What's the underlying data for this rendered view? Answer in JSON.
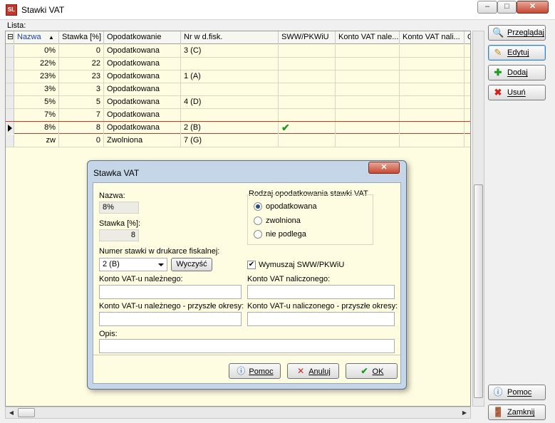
{
  "window": {
    "title": "Stawki VAT",
    "icon_label": "SL",
    "controls": {
      "minimize": "–",
      "maximize": "□",
      "close": "✕"
    }
  },
  "lista_label": "Lista:",
  "grid": {
    "columns": [
      "Nazwa",
      "Stawka [%]",
      "Opodatkowanie",
      "Nr w d.fisk.",
      "SWW/PKWiU",
      "Konto VAT nale...",
      "Konto VAT nali...",
      "O"
    ],
    "sort_indicator": "▲",
    "rows": [
      {
        "nazwa": "0%",
        "stawka": "0",
        "opodatkowanie": "Opodatkowana",
        "nr": "3 (C)",
        "sww": ""
      },
      {
        "nazwa": "22%",
        "stawka": "22",
        "opodatkowanie": "Opodatkowana",
        "nr": "",
        "sww": ""
      },
      {
        "nazwa": "23%",
        "stawka": "23",
        "opodatkowanie": "Opodatkowana",
        "nr": "1 (A)",
        "sww": ""
      },
      {
        "nazwa": "3%",
        "stawka": "3",
        "opodatkowanie": "Opodatkowana",
        "nr": "",
        "sww": ""
      },
      {
        "nazwa": "5%",
        "stawka": "5",
        "opodatkowanie": "Opodatkowana",
        "nr": "4 (D)",
        "sww": ""
      },
      {
        "nazwa": "7%",
        "stawka": "7",
        "opodatkowanie": "Opodatkowana",
        "nr": "",
        "sww": ""
      },
      {
        "nazwa": "8%",
        "stawka": "8",
        "opodatkowanie": "Opodatkowana",
        "nr": "2 (B)",
        "sww": "✔"
      },
      {
        "nazwa": "zw",
        "stawka": "0",
        "opodatkowanie": "Zwolniona",
        "nr": "7 (G)",
        "sww": ""
      }
    ],
    "selected_row_index": 6
  },
  "side_buttons": {
    "przegladaj": "Przeglądaj",
    "edytuj": "Edytuj",
    "dodaj": "Dodaj",
    "usun": "Usuń",
    "pomoc": "Pomoc",
    "zamknij": "Zamknij"
  },
  "dialog": {
    "title": "Stawka VAT",
    "close": "✕",
    "nazwa_label": "Nazwa:",
    "nazwa_value": "8%",
    "stawka_label": "Stawka [%]:",
    "stawka_value": "8",
    "rodzaj_label": "Rodzaj opodatkowania stawki VAT",
    "rodzaj_options": [
      "opodatkowana",
      "zwolniona",
      "nie podlega"
    ],
    "rodzaj_selected": "opodatkowana",
    "numer_label": "Numer stawki w drukarce fiskalnej:",
    "numer_value": "2 (B)",
    "wyczysc": "Wyczyść",
    "wymuszaj_label": "Wymuszaj SWW/PKWiU",
    "wymuszaj_checked": true,
    "konto_nalezny_label": "Konto VAT-u należnego:",
    "konto_nalezny_value": "",
    "konto_naliczony_label": "Konto VAT naliczonego:",
    "konto_naliczony_value": "",
    "konto_nalezny_przyszle_label": "Konto VAT-u należnego - przyszłe okresy:",
    "konto_nalezny_przyszle_value": "",
    "konto_naliczony_przyszle_label": "Konto VAT-u naliczonego - przyszłe okresy:",
    "konto_naliczony_przyszle_value": "",
    "opis_label": "Opis:",
    "opis_value": "",
    "buttons": {
      "pomoc": "Pomoc",
      "anuluj": "Anuluj",
      "ok": "OK"
    }
  },
  "colors": {
    "grid_background": "#fffde1",
    "selection_border": "#c0392b",
    "dialog_frame": "#c5d6e8",
    "check_green": "#1f9a1f"
  }
}
